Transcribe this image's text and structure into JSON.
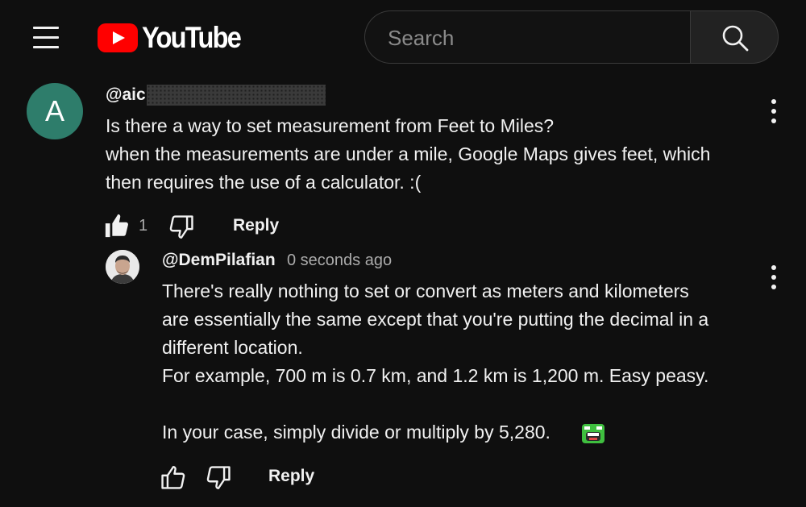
{
  "header": {
    "logo_text": "YouTube",
    "search_placeholder": "Search"
  },
  "icons": {
    "menu": "hamburger-menu-icon",
    "search": "search-icon",
    "more": "vertical-ellipsis-icon",
    "like": "thumbs-up-icon",
    "dislike": "thumbs-down-icon"
  },
  "colors": {
    "background": "#0f0f0f",
    "brand_red": "#ff0000",
    "avatar_teal": "#2e7d6b",
    "muted_text": "#aaaaaa"
  },
  "comment": {
    "avatar_letter": "A",
    "author_prefix": "@aic",
    "text": "Is there a way to set measurement from Feet to Miles?\nwhen the measurements are under a mile, Google Maps gives feet, which\nthen requires the use of a calculator. :(",
    "like_count": "1",
    "reply_label": "Reply"
  },
  "reply_comment": {
    "author": "@DemPilafian",
    "timestamp": "0 seconds ago",
    "text": "There's really nothing to set or convert as meters and kilometers\nare essentially the same except that you're putting the decimal in a\ndifferent location.\nFor example, 700 m is 0.7 km, and 1.2 km is 1,200 m.  Easy peasy.\n\nIn your case, simply divide or multiply by 5,280.",
    "reply_label": "Reply"
  }
}
